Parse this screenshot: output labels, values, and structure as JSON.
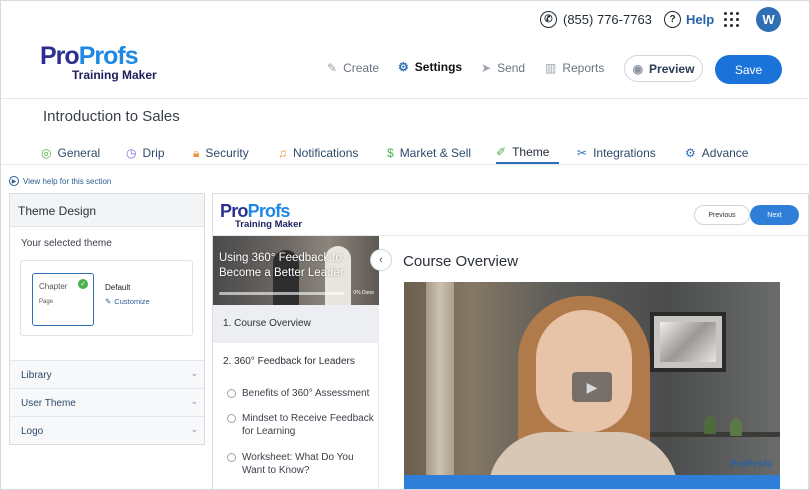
{
  "topbar": {
    "phone": "(855) 776-7763",
    "help": "Help",
    "avatar_initial": "W"
  },
  "header": {
    "logo_pro": "Pro",
    "logo_profs": "Profs",
    "logo_sub": "Training Maker",
    "nav": {
      "create": "Create",
      "settings": "Settings",
      "send": "Send",
      "reports": "Reports"
    },
    "preview": "Preview",
    "save": "Save"
  },
  "course": {
    "title": "Introduction to Sales"
  },
  "tabs": {
    "general": "General",
    "drip": "Drip",
    "security": "Security",
    "notifications": "Notifications",
    "market": "Market & Sell",
    "theme": "Theme",
    "integrations": "Integrations",
    "advance": "Advance",
    "active": "Theme"
  },
  "help_link": "View help for this section",
  "theme_panel": {
    "title": "Theme Design",
    "selected_label": "Your selected theme",
    "thumb_title": "Chapter",
    "thumb_sub": "Page",
    "default_label": "Default",
    "customize": "Customize",
    "sections": {
      "library": "Library",
      "user_theme": "User Theme",
      "logo": "Logo"
    }
  },
  "preview": {
    "logo_pro": "Pro",
    "logo_profs": "Profs",
    "logo_sub": "Training Maker",
    "previous": "Previous",
    "next": "Next",
    "banner_title": "Using 360° Feedback to Become a Better Leader",
    "banner_progress": "0% Done",
    "lessons": {
      "l1": "1. Course Overview",
      "l2": "2. 360° Feedback for Leaders"
    },
    "sub_items": {
      "s1": "Benefits of 360° Assessment",
      "s2": "Mindset to Receive Feedback for Learning",
      "s3": "Worksheet: What Do You Want to Know?"
    },
    "main_title": "Course Overview",
    "video_watermark": "ProProfs"
  },
  "colors": {
    "primary": "#1a73d9",
    "brand_dark": "#2b2f8f",
    "brand_light": "#1e88e5",
    "check_green": "#4caf50"
  }
}
